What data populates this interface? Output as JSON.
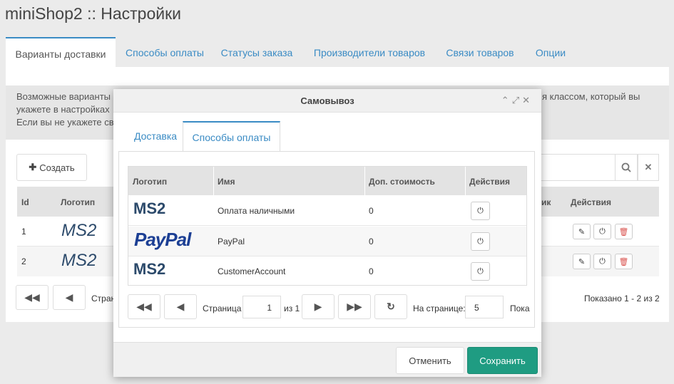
{
  "page": {
    "title": "miniShop2 :: Настройки"
  },
  "tabs": [
    "Варианты доставки",
    "Способы оплаты",
    "Статусы заказа",
    "Производители товаров",
    "Связи товаров",
    "Опции"
  ],
  "description": {
    "line1": "Возможные варианты",
    "line2": "укажете в настройках",
    "line3": "Если вы не укажете св",
    "line1_right": "я классом, который вы"
  },
  "toolbar": {
    "create_label": "Создать"
  },
  "main_table": {
    "headers": {
      "id": "Id",
      "logo": "Логотип",
      "partial": "ик",
      "actions": "Действия"
    },
    "rows": [
      {
        "id": "1",
        "logo": "MS2"
      },
      {
        "id": "2",
        "logo": "MS2"
      }
    ]
  },
  "main_pager": {
    "page_label": "Страни",
    "shown": "Показано 1 - 2 из 2"
  },
  "modal": {
    "title": "Самовывоз",
    "tabs": [
      "Доставка",
      "Способы оплаты"
    ],
    "table": {
      "headers": [
        "Логотип",
        "Имя",
        "Доп. стоимость",
        "Действия"
      ],
      "rows": [
        {
          "logo": "MS2",
          "name": "Оплата наличными",
          "cost": "0"
        },
        {
          "logo": "PayPal",
          "name": "PayPal",
          "cost": "0"
        },
        {
          "logo": "MS2",
          "name": "CustomerAccount",
          "cost": "0"
        }
      ]
    },
    "pager": {
      "page_label": "Страница",
      "page_value": "1",
      "of_label": "из 1",
      "per_page_label": "На странице:",
      "per_page_value": "5",
      "shown_partial": "Пока"
    },
    "cancel_label": "Отменить",
    "save_label": "Сохранить"
  },
  "colors": {
    "accent": "#3a8bc4",
    "save": "#1f9c82",
    "danger": "#d9534f"
  }
}
